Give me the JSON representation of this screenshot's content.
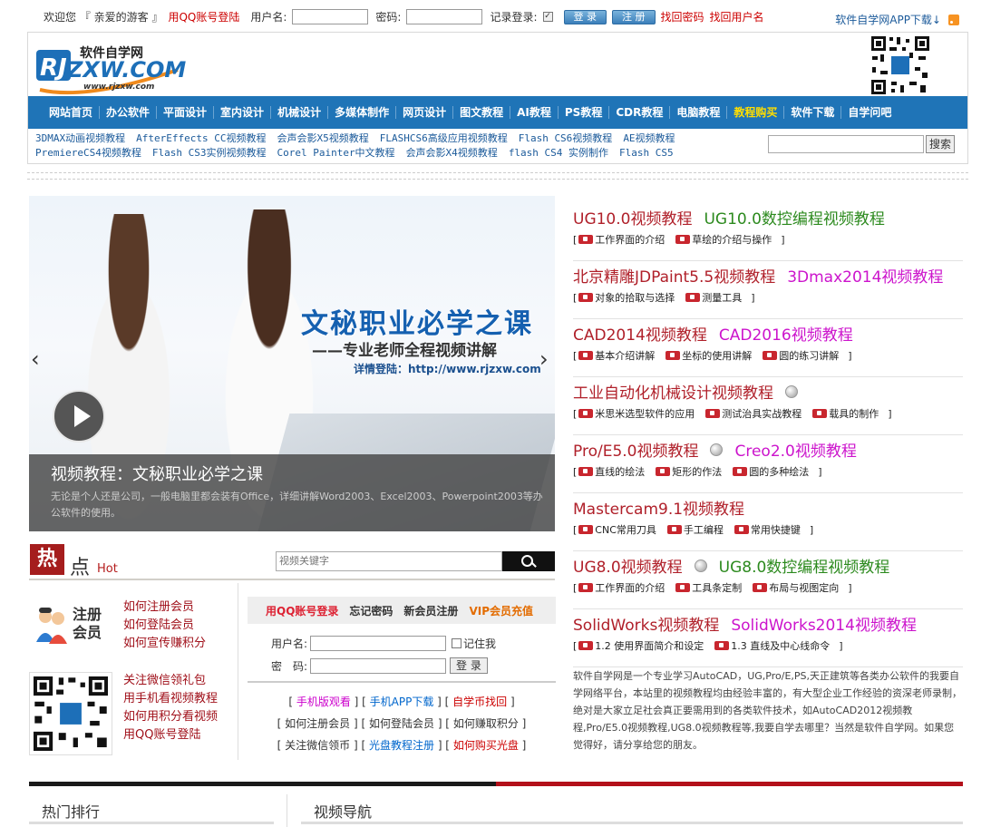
{
  "topbar": {
    "welcome": "欢迎您 『 亲爱的游客 』",
    "qq_login": "用QQ账号登陆",
    "username_label": "用户名:",
    "password_label": "密码:",
    "remember_label": "记录登录:",
    "login_btn": "登 录",
    "register_btn": "注 册",
    "find_password": "找回密码",
    "find_username": "找回用户名",
    "app_download": "软件自学网APP下载↓"
  },
  "logo": {
    "cn": "软件自学网",
    "en": "ZXW.COM",
    "url": "www.rjzxw.com",
    "mark": "RJ"
  },
  "nav": [
    "网站首页",
    "办公软件",
    "平面设计",
    "室内设计",
    "机械设计",
    "多媒体制作",
    "网页设计",
    "图文教程",
    "AI教程",
    "PS教程",
    "CDR教程",
    "电脑教程",
    "教程购买",
    "软件下载",
    "自学问吧"
  ],
  "sublinks": {
    "row1": [
      "3DMAX动画视频教程",
      "AfterEffects CC视频教程",
      "会声会影X5视频教程",
      "FLASHCS6高级应用视频教程",
      "Flash CS6视频教程",
      "AE视频教程"
    ],
    "row2": [
      "PremiereCS4视频教程",
      "Flash CS3实例视频教程",
      "Corel Painter中文教程",
      "会声会影X4视频教程",
      "flash CS4 实例制作",
      "Flash CS5"
    ]
  },
  "topsearch": {
    "button": "搜索"
  },
  "slider": {
    "headline": "文秘职业必学之课",
    "subline": "——专业老师全程视频讲解",
    "url_line": "详情登陆：http://www.rjzxw.com",
    "caption_title": "视频教程：文秘职业必学之课",
    "caption_desc": "无论是个人还是公司，一般电脑里都会装有Office，详细讲解Word2003、Excel2003、Powerpoint2003等办公软件的使用。",
    "prev": "‹",
    "next": "›"
  },
  "hot": {
    "badge": "热",
    "title": "点",
    "en": "Hot",
    "search_placeholder": "视频关键字"
  },
  "member": {
    "title": "注册会员",
    "links1": [
      "如何注册会员",
      "如何登陆会员",
      "如何宣传赚积分"
    ],
    "links2": [
      "关注微信领礼包",
      "用手机看视频教程",
      "如何用积分看视频",
      "用QQ账号登陆"
    ]
  },
  "login": {
    "tabs": [
      "用QQ账号登录",
      "忘记密码",
      "新会员注册",
      "VIP会员充值"
    ],
    "username_label": "用户名:",
    "password_label": "密　码:",
    "remember": "记住我",
    "login_btn": "登 录",
    "links": [
      [
        "手机版观看",
        "手机APP下载",
        "自学币找回"
      ],
      [
        "如何注册会员",
        "如何登陆会员",
        "如何赚取积分"
      ],
      [
        "关注微信领币",
        "光盘教程注册",
        "如何购买光盘"
      ]
    ]
  },
  "courses": [
    {
      "titles": [
        [
          "UG10.0视频教程",
          "red"
        ],
        [
          "UG10.0数控编程视频教程",
          "green"
        ]
      ],
      "subs": [
        "工作界面的介绍",
        "草绘的介绍与操作"
      ]
    },
    {
      "titles": [
        [
          "北京精雕JDPaint5.5视频教程",
          "red"
        ],
        [
          "3Dmax2014视频教程",
          "mag"
        ]
      ],
      "subs": [
        "对象的拾取与选择",
        "测量工具"
      ]
    },
    {
      "titles": [
        [
          "CAD2014视频教程",
          "red"
        ],
        [
          "CAD2016视频教程",
          "mag"
        ]
      ],
      "subs": [
        "基本介绍讲解",
        "坐标的使用讲解",
        "圆的练习讲解"
      ]
    },
    {
      "titles": [
        [
          "工业自动化机械设计视频教程",
          "red"
        ]
      ],
      "globe": true,
      "subs": [
        "米思米选型软件的应用",
        "测试治具实战教程",
        "载具的制作"
      ]
    },
    {
      "titles": [
        [
          "Pro/E5.0视频教程",
          "red"
        ],
        [
          "Creo2.0视频教程",
          "mag"
        ]
      ],
      "globe_after_first": true,
      "subs": [
        "直线的绘法",
        "矩形的作法",
        "圆的多种绘法"
      ]
    },
    {
      "titles": [
        [
          "Mastercam9.1视频教程",
          "red"
        ]
      ],
      "subs": [
        "CNC常用刀具",
        "手工编程",
        "常用快捷键"
      ]
    },
    {
      "titles": [
        [
          "UG8.0视频教程",
          "red"
        ],
        [
          "UG8.0数控编程视频教程",
          "green"
        ]
      ],
      "globe_after_first": true,
      "subs": [
        "工作界面的介绍",
        "工具条定制",
        "布局与视图定向"
      ]
    },
    {
      "titles": [
        [
          "SolidWorks视频教程",
          "red"
        ],
        [
          "SolidWorks2014视频教程",
          "mag"
        ]
      ],
      "subs": [
        "1.2 使用界面简介和设定",
        "1.3 直线及中心线命令"
      ]
    }
  ],
  "intro": "软件自学网是一个专业学习AutoCAD，UG,Pro/E,PS,天正建筑等各类办公软件的我要自学网络平台，本站里的视频教程均由经验丰富的，有大型企业工作经验的资深老师录制，绝对是大家立足社会真正要需用到的各类软件技术，如AutoCAD2012视频教程,Pro/E5.0视频教程,UG8.0视频教程等,我要自学去哪里？当然是软件自学网。如果您觉得好，请分享给您的朋友。",
  "bottom": {
    "rank": "热门排行",
    "video_nav": "视频导航"
  }
}
